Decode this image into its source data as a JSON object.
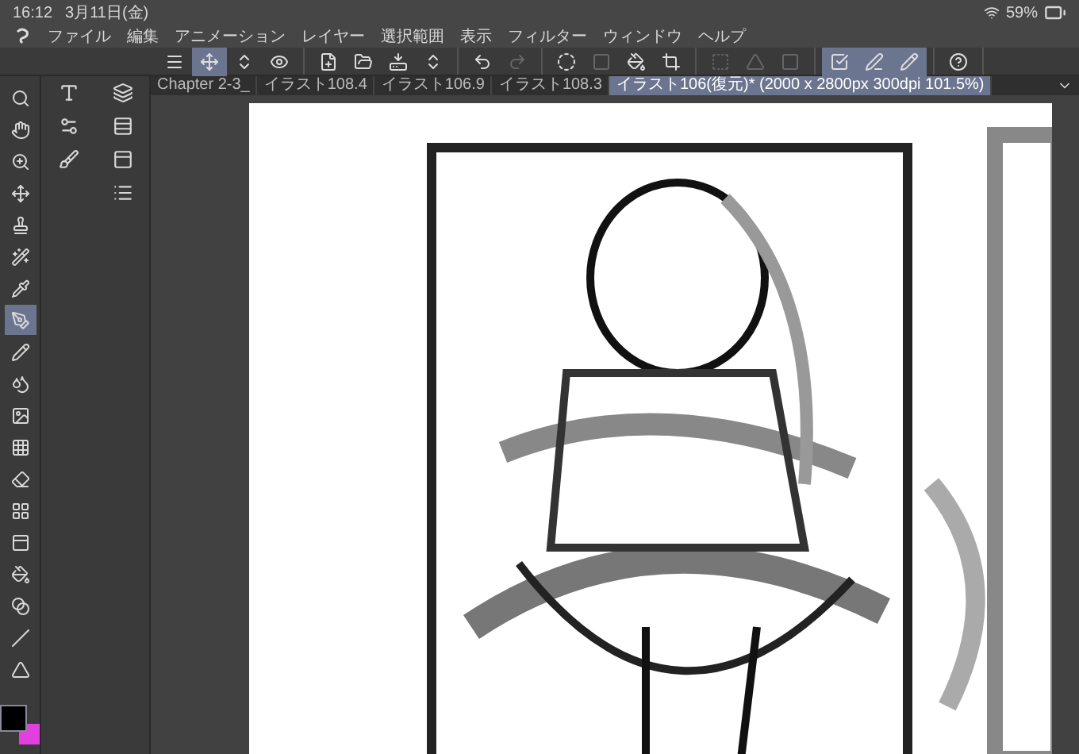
{
  "status_bar": {
    "time": "16:12",
    "date": "3月11日(金)",
    "battery": "59%"
  },
  "menu": [
    "ファイル",
    "編集",
    "アニメーション",
    "レイヤー",
    "選択範囲",
    "表示",
    "フィルター",
    "ウィンドウ",
    "ヘルプ"
  ],
  "toolbar": {
    "groups": [
      [
        {
          "selected": false,
          "disabled": false
        },
        {
          "selected": true,
          "disabled": false
        },
        {
          "selected": false,
          "disabled": false
        },
        {
          "selected": false,
          "disabled": false
        }
      ],
      [
        {
          "selected": false,
          "disabled": false
        },
        {
          "selected": false,
          "disabled": false
        },
        {
          "selected": false,
          "disabled": false
        },
        {
          "selected": false,
          "disabled": false
        }
      ],
      [
        {
          "selected": false,
          "disabled": false
        },
        {
          "selected": false,
          "disabled": true
        }
      ],
      [
        {
          "selected": false,
          "disabled": false
        },
        {
          "selected": false,
          "disabled": true
        },
        {
          "selected": false,
          "disabled": false
        },
        {
          "selected": false,
          "disabled": false
        }
      ],
      [
        {
          "selected": false,
          "disabled": true
        },
        {
          "selected": false,
          "disabled": true
        },
        {
          "selected": false,
          "disabled": true
        }
      ],
      [
        {
          "selected": true,
          "disabled": false
        },
        {
          "selected": true,
          "disabled": false
        },
        {
          "selected": true,
          "disabled": false
        }
      ],
      [
        {
          "selected": false,
          "disabled": false
        }
      ]
    ]
  },
  "tabs": [
    {
      "label": "Chapter 2-3_",
      "selected": false
    },
    {
      "label": "イラスト108.4",
      "selected": false
    },
    {
      "label": "イラスト106.9",
      "selected": false
    },
    {
      "label": "イラスト108.3",
      "selected": false
    },
    {
      "label": "イラスト106(復元)* (2000 x 2800px 300dpi 101.5%)",
      "selected": true
    }
  ],
  "tools": [
    {
      "selected": false
    },
    {
      "selected": false
    },
    {
      "selected": false
    },
    {
      "selected": false
    },
    {
      "selected": false
    },
    {
      "selected": false
    },
    {
      "selected": false
    },
    {
      "selected": true
    },
    {
      "selected": false
    },
    {
      "selected": false
    },
    {
      "selected": false
    },
    {
      "selected": false
    },
    {
      "selected": false
    },
    {
      "selected": false
    },
    {
      "selected": false
    },
    {
      "selected": false
    },
    {
      "selected": false
    },
    {
      "selected": false
    },
    {
      "selected": false
    }
  ],
  "color_swatches": [
    {
      "color": "#000000"
    },
    {
      "color": "#e23fe0"
    }
  ]
}
